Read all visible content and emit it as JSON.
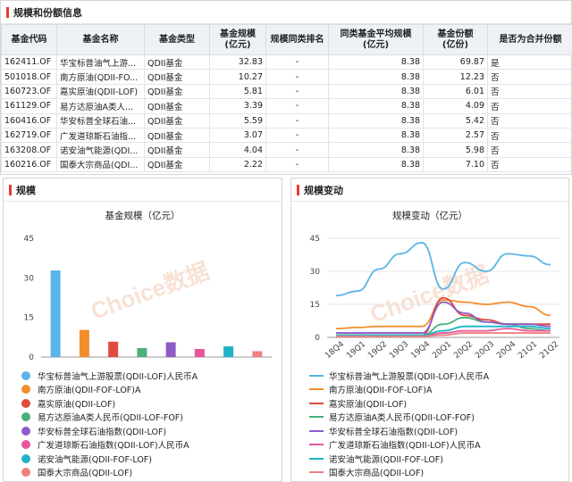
{
  "top": {
    "title": "规模和份额信息",
    "columns": [
      "基金代码",
      "基金名称",
      "基金类型",
      "基金规模\n(亿元)",
      "规模同类排名",
      "同类基金平均规模\n(亿元)",
      "基金份额\n(亿份)",
      "是否为合并份额"
    ],
    "rows": [
      [
        "162411.OF",
        "华宝标普油气上游...",
        "QDII基金",
        "32.83",
        "-",
        "8.38",
        "69.87",
        "是"
      ],
      [
        "501018.OF",
        "南方原油(QDII-FO...",
        "QDII基金",
        "10.27",
        "-",
        "8.38",
        "12.23",
        "否"
      ],
      [
        "160723.OF",
        "嘉实原油(QDII-LOF)",
        "QDII基金",
        "5.81",
        "-",
        "8.38",
        "6.01",
        "否"
      ],
      [
        "161129.OF",
        "易方达原油A类人...",
        "QDII基金",
        "3.39",
        "-",
        "8.38",
        "4.09",
        "否"
      ],
      [
        "160416.OF",
        "华安标普全球石油...",
        "QDII基金",
        "5.59",
        "-",
        "8.38",
        "5.42",
        "否"
      ],
      [
        "162719.OF",
        "广发道琼斯石油指...",
        "QDII基金",
        "3.07",
        "-",
        "8.38",
        "2.57",
        "否"
      ],
      [
        "163208.OF",
        "诺安油气能源(QDI...",
        "QDII基金",
        "4.04",
        "-",
        "8.38",
        "5.98",
        "否"
      ],
      [
        "160216.OF",
        "国泰大宗商品(QDI...",
        "QDII基金",
        "2.22",
        "-",
        "8.38",
        "7.10",
        "否"
      ]
    ]
  },
  "left": {
    "title": "规模",
    "watermark": "Choice数据",
    "legend": [
      {
        "label": "华宝标普油气上游股票(QDII-LOF)人民币A",
        "color": "#5ab4e8"
      },
      {
        "label": "南方原油(QDII-FOF-LOF)A",
        "color": "#f28e2b"
      },
      {
        "label": "嘉实原油(QDII-LOF)",
        "color": "#e04a3f"
      },
      {
        "label": "易方达原油A类人民币(QDII-LOF-FOF)",
        "color": "#4caf7a"
      },
      {
        "label": "华安标普全球石油指数(QDII-LOF)",
        "color": "#8e5cc6"
      },
      {
        "label": "广发道琼斯石油指数(QDII-LOF)人民币A",
        "color": "#e8569a"
      },
      {
        "label": "诺安油气能源(QDII-FOF-LOF)",
        "color": "#1fb3c8"
      },
      {
        "label": "国泰大宗商品(QDII-LOF)",
        "color": "#f08080"
      }
    ]
  },
  "right": {
    "title": "规模变动",
    "watermark": "Choice数据"
  },
  "chart_data": [
    {
      "type": "bar",
      "title": "基金规模（亿元）",
      "categories": [
        "华宝标普油气上游股票(QDII-LOF)人民币A",
        "南方原油(QDII-FOF-LOF)A",
        "嘉实原油(QDII-LOF)",
        "易方达原油A类人民币(QDII-LOF-FOF)",
        "华安标普全球石油指数(QDII-LOF)",
        "广发道琼斯石油指数(QDII-LOF)人民币A",
        "诺安油气能源(QDII-FOF-LOF)",
        "国泰大宗商品(QDII-LOF)"
      ],
      "values": [
        32.83,
        10.27,
        5.81,
        3.39,
        5.59,
        3.07,
        4.04,
        2.22
      ],
      "colors": [
        "#5ab4e8",
        "#f28e2b",
        "#e04a3f",
        "#4caf7a",
        "#8e5cc6",
        "#e8569a",
        "#1fb3c8",
        "#f08080"
      ],
      "yticks": [
        0,
        15,
        30,
        45
      ],
      "ylim": [
        0,
        45
      ],
      "grid": false,
      "legend": "bottom"
    },
    {
      "type": "line",
      "title": "规模变动（亿元）",
      "x": [
        "18Q4",
        "19Q1",
        "19Q2",
        "19Q3",
        "19Q4",
        "20Q1",
        "20Q2",
        "20Q3",
        "20Q4",
        "21Q1",
        "21Q2"
      ],
      "yticks": [
        0,
        15,
        30,
        45
      ],
      "ylim": [
        0,
        45
      ],
      "grid": true,
      "legend": "bottom",
      "series": [
        {
          "name": "华宝标普油气上游股票(QDII-LOF)人民币A",
          "color": "#5ab4e8",
          "values": [
            19,
            21,
            31,
            38,
            43,
            22,
            34,
            30,
            38,
            37,
            33
          ]
        },
        {
          "name": "南方原油(QDII-FOF-LOF)A",
          "color": "#f28e2b",
          "values": [
            4,
            4.5,
            5,
            5,
            5,
            17,
            16,
            15,
            16,
            14,
            10
          ]
        },
        {
          "name": "嘉实原油(QDII-LOF)",
          "color": "#e04a3f",
          "values": [
            1,
            1,
            1,
            1,
            1,
            18,
            10,
            8,
            6,
            6,
            6
          ]
        },
        {
          "name": "易方达原油A类人民币(QDII-LOF-FOF)",
          "color": "#4caf7a",
          "values": [
            1,
            1,
            1,
            1,
            1,
            6,
            9,
            7,
            6,
            4,
            3
          ]
        },
        {
          "name": "华安标普全球石油指数(QDII-LOF)",
          "color": "#8e5cc6",
          "values": [
            2,
            2,
            2,
            2,
            2,
            16,
            11,
            7,
            6,
            6,
            5
          ]
        },
        {
          "name": "广发道琼斯石油指数(QDII-LOF)人民币A",
          "color": "#e8569a",
          "values": [
            0.5,
            0.5,
            0.6,
            0.6,
            0.6,
            2,
            3,
            3,
            4,
            3,
            3
          ]
        },
        {
          "name": "诺安油气能源(QDII-FOF-LOF)",
          "color": "#1fb3c8",
          "values": [
            1,
            1,
            1,
            1,
            1,
            3,
            5,
            5,
            5,
            5,
            4
          ]
        },
        {
          "name": "国泰大宗商品(QDII-LOF)",
          "color": "#f08080",
          "values": [
            0.5,
            0.5,
            0.5,
            0.5,
            0.5,
            1,
            2,
            2,
            2,
            2,
            2
          ]
        }
      ]
    }
  ]
}
